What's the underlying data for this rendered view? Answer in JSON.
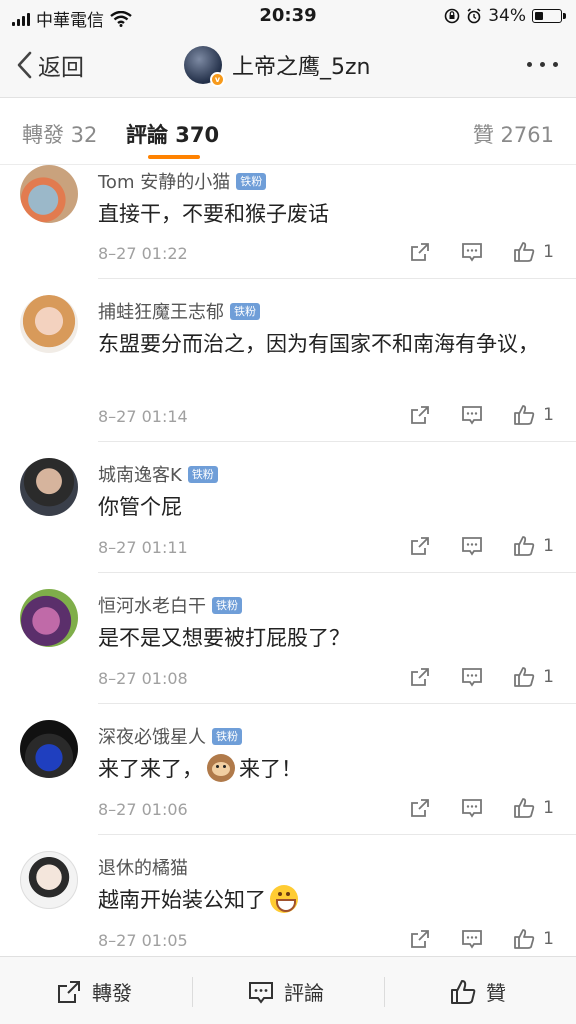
{
  "status_bar": {
    "carrier": "中華電信",
    "time": "20:39",
    "battery_percent": "34%",
    "battery_level": 0.34
  },
  "nav": {
    "back_label": "返回",
    "title": "上帝之鹰_5zn"
  },
  "tabs": [
    {
      "label": "轉發 32"
    },
    {
      "label": "評論 370"
    },
    {
      "label": "贊 2761"
    }
  ],
  "comments": [
    {
      "name": "Tom 安静的小猫",
      "badge": "铁粉",
      "text": "直接干，不要和猴子废话",
      "time": "8–27 01:22",
      "likes": "1"
    },
    {
      "name": "捕蛙狂魔王志郁",
      "badge": "铁粉",
      "text": "东盟要分而治之，因为有国家不和南海有争议，",
      "time": "8–27 01:14",
      "likes": "1"
    },
    {
      "name": "城南逸客K",
      "badge": "铁粉",
      "text": "你管个屁",
      "time": "8–27 01:11",
      "likes": "1"
    },
    {
      "name": "恒河水老白干",
      "badge": "铁粉",
      "text": "是不是又想要被打屁股了？",
      "time": "8–27 01:08",
      "likes": "1"
    },
    {
      "name": "深夜必饿星人",
      "badge": "铁粉",
      "text_a": "来了来了，",
      "text_b": "来了！",
      "time": "8–27 01:06",
      "likes": "1"
    },
    {
      "name": "退休的橘猫",
      "text_a": "越南开始装公知了",
      "time": "8–27 01:05",
      "likes": "1"
    }
  ],
  "bottom_bar": {
    "forward": "轉發",
    "comment": "評論",
    "like": "贊"
  }
}
